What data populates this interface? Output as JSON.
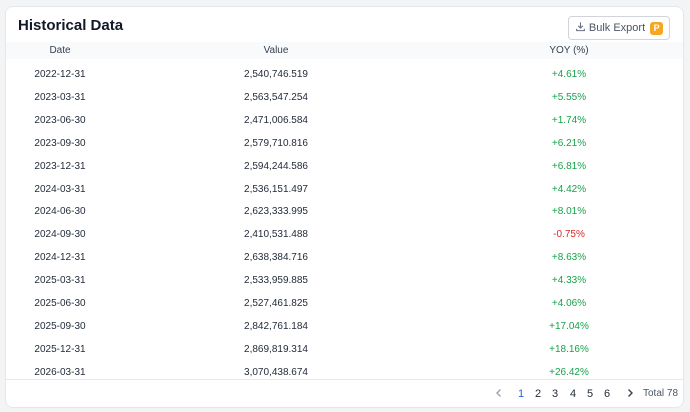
{
  "card": {
    "title": "Historical Data",
    "export_label": "Bulk Export",
    "pro_badge": "P"
  },
  "table": {
    "columns": [
      "Date",
      "Value",
      "YOY (%)"
    ],
    "rows": [
      {
        "date": "2022-12-31",
        "value": "2,540,746.519",
        "yoy": "+4.61%",
        "trend": "up"
      },
      {
        "date": "2023-03-31",
        "value": "2,563,547.254",
        "yoy": "+5.55%",
        "trend": "up"
      },
      {
        "date": "2023-06-30",
        "value": "2,471,006.584",
        "yoy": "+1.74%",
        "trend": "up"
      },
      {
        "date": "2023-09-30",
        "value": "2,579,710.816",
        "yoy": "+6.21%",
        "trend": "up"
      },
      {
        "date": "2023-12-31",
        "value": "2,594,244.586",
        "yoy": "+6.81%",
        "trend": "up"
      },
      {
        "date": "2024-03-31",
        "value": "2,536,151.497",
        "yoy": "+4.42%",
        "trend": "up"
      },
      {
        "date": "2024-06-30",
        "value": "2,623,333.995",
        "yoy": "+8.01%",
        "trend": "up"
      },
      {
        "date": "2024-09-30",
        "value": "2,410,531.488",
        "yoy": "-0.75%",
        "trend": "down"
      },
      {
        "date": "2024-12-31",
        "value": "2,638,384.716",
        "yoy": "+8.63%",
        "trend": "up"
      },
      {
        "date": "2025-03-31",
        "value": "2,533,959.885",
        "yoy": "+4.33%",
        "trend": "up"
      },
      {
        "date": "2025-06-30",
        "value": "2,527,461.825",
        "yoy": "+4.06%",
        "trend": "up"
      },
      {
        "date": "2025-09-30",
        "value": "2,842,761.184",
        "yoy": "+17.04%",
        "trend": "up"
      },
      {
        "date": "2025-12-31",
        "value": "2,869,819.314",
        "yoy": "+18.16%",
        "trend": "up"
      },
      {
        "date": "2026-03-31",
        "value": "3,070,438.674",
        "yoy": "+26.42%",
        "trend": "up"
      }
    ]
  },
  "pagination": {
    "pages": [
      "1",
      "2",
      "3",
      "4",
      "5",
      "6"
    ],
    "current_page": "1",
    "total_label": "Total 78",
    "prev_icon": "chevron-left-icon",
    "next_icon": "chevron-right-icon"
  },
  "colors": {
    "positive": "#16a34a",
    "negative": "#dc2626",
    "active_page": "#2563eb",
    "badge": "#f5a623"
  }
}
